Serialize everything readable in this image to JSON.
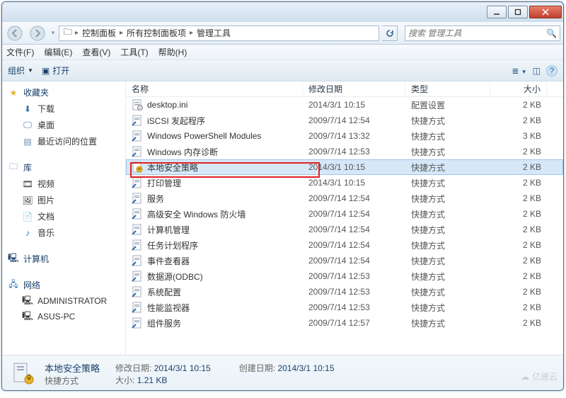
{
  "breadcrumbs": [
    "控制面板",
    "所有控制面板项",
    "管理工具"
  ],
  "search_placeholder": "搜索 管理工具",
  "menubar": [
    "文件(F)",
    "编辑(E)",
    "查看(V)",
    "工具(T)",
    "帮助(H)"
  ],
  "toolbar": {
    "organize": "组织",
    "open": "打开"
  },
  "sidebar": {
    "favorites": {
      "label": "收藏夹",
      "items": [
        "下载",
        "桌面",
        "最近访问的位置"
      ]
    },
    "libraries": {
      "label": "库",
      "items": [
        "视频",
        "图片",
        "文档",
        "音乐"
      ]
    },
    "computer": {
      "label": "计算机"
    },
    "network": {
      "label": "网络",
      "items": [
        "ADMINISTRATOR",
        "ASUS-PC"
      ]
    }
  },
  "columns": {
    "name": "名称",
    "date": "修改日期",
    "type": "类型",
    "size": "大小"
  },
  "files": [
    {
      "name": "desktop.ini",
      "date": "2014/3/1 10:15",
      "type": "配置设置",
      "size": "2 KB",
      "icon": "ini"
    },
    {
      "name": "iSCSI 发起程序",
      "date": "2009/7/14 12:54",
      "type": "快捷方式",
      "size": "2 KB",
      "icon": "lnk"
    },
    {
      "name": "Windows PowerShell Modules",
      "date": "2009/7/14 13:32",
      "type": "快捷方式",
      "size": "3 KB",
      "icon": "lnk"
    },
    {
      "name": "Windows 内存诊断",
      "date": "2009/7/14 12:53",
      "type": "快捷方式",
      "size": "2 KB",
      "icon": "lnk"
    },
    {
      "name": "本地安全策略",
      "date": "2014/3/1 10:15",
      "type": "快捷方式",
      "size": "2 KB",
      "icon": "sec",
      "selected": true
    },
    {
      "name": "打印管理",
      "date": "2014/3/1 10:15",
      "type": "快捷方式",
      "size": "2 KB",
      "icon": "lnk"
    },
    {
      "name": "服务",
      "date": "2009/7/14 12:54",
      "type": "快捷方式",
      "size": "2 KB",
      "icon": "lnk"
    },
    {
      "name": "高级安全 Windows 防火墙",
      "date": "2009/7/14 12:54",
      "type": "快捷方式",
      "size": "2 KB",
      "icon": "lnk"
    },
    {
      "name": "计算机管理",
      "date": "2009/7/14 12:54",
      "type": "快捷方式",
      "size": "2 KB",
      "icon": "lnk"
    },
    {
      "name": "任务计划程序",
      "date": "2009/7/14 12:54",
      "type": "快捷方式",
      "size": "2 KB",
      "icon": "lnk"
    },
    {
      "name": "事件查看器",
      "date": "2009/7/14 12:54",
      "type": "快捷方式",
      "size": "2 KB",
      "icon": "lnk"
    },
    {
      "name": "数据源(ODBC)",
      "date": "2009/7/14 12:53",
      "type": "快捷方式",
      "size": "2 KB",
      "icon": "lnk"
    },
    {
      "name": "系统配置",
      "date": "2009/7/14 12:53",
      "type": "快捷方式",
      "size": "2 KB",
      "icon": "lnk"
    },
    {
      "name": "性能监视器",
      "date": "2009/7/14 12:53",
      "type": "快捷方式",
      "size": "2 KB",
      "icon": "lnk"
    },
    {
      "name": "组件服务",
      "date": "2009/7/14 12:57",
      "type": "快捷方式",
      "size": "2 KB",
      "icon": "lnk"
    }
  ],
  "details": {
    "title": "本地安全策略",
    "sub": "快捷方式",
    "meta": {
      "mod_label": "修改日期:",
      "mod_value": "2014/3/1 10:15",
      "create_label": "创建日期:",
      "create_value": "2014/3/1 10:15",
      "size_label": "大小:",
      "size_value": "1.21 KB"
    }
  },
  "watermark": "亿速云"
}
